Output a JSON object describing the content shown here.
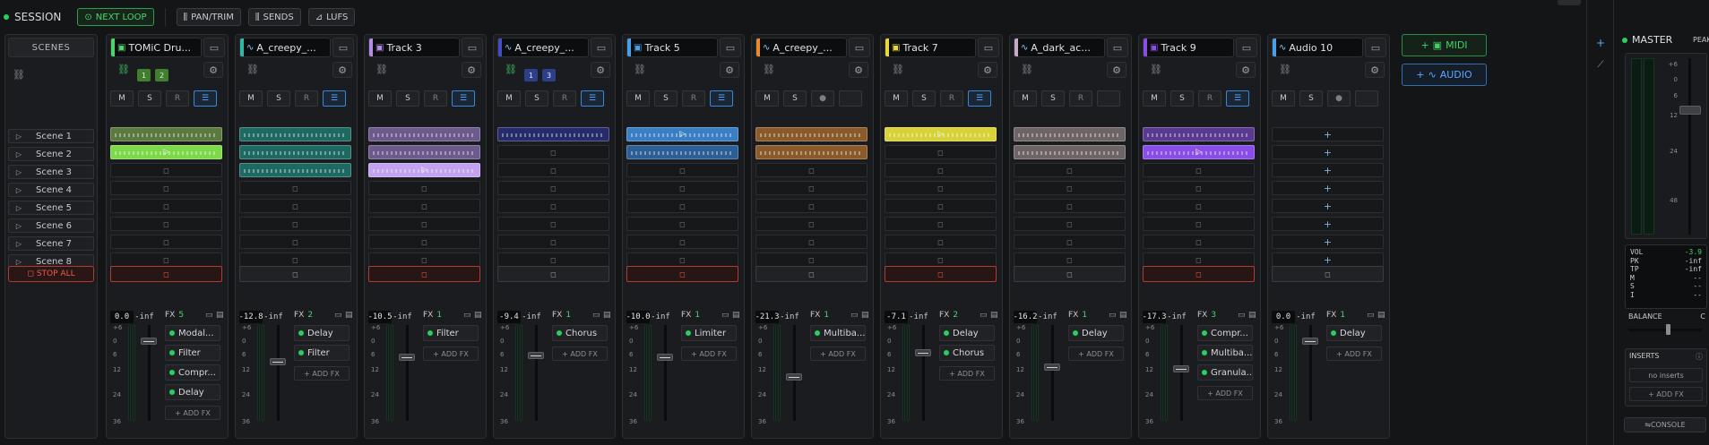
{
  "topbar": {
    "session_label": "SESSION",
    "next_loop": "NEXT LOOP",
    "pan_trim": "PAN/TRIM",
    "sends": "SENDS",
    "lufs": "LUFS"
  },
  "scenes": {
    "header": "SCENES",
    "items": [
      "Scene 1",
      "Scene 2",
      "Scene 3",
      "Scene 4",
      "Scene 5",
      "Scene 6",
      "Scene 7",
      "Scene 8"
    ],
    "stop_all": "STOP ALL"
  },
  "buttons": {
    "mute": "M",
    "solo": "S",
    "rec": "R",
    "monitor_icon": "menu-lines-icon"
  },
  "add_fx_label": "+ ADD FX",
  "tracks": [
    {
      "name": "TOMiC Dru...",
      "kind": "midi",
      "color": "#4fd46c",
      "linked": true,
      "chips": [
        "1",
        "2"
      ],
      "chip_color": "#3f7f2e",
      "vol": "0.0",
      "peak": "-inf",
      "fx_count": "5",
      "fx": [
        "Modal...",
        "Filter",
        "Compr...",
        "Delay"
      ],
      "clips": [
        {
          "c": "#5b7a3f",
          "p": false
        },
        {
          "c": "#7dd84a",
          "p": true
        }
      ],
      "red_stop": true,
      "rec_mode": "R",
      "mon": true,
      "fader": 0.13
    },
    {
      "name": "A_creepy_...",
      "kind": "audio",
      "color": "#2fb8a8",
      "linked": false,
      "chips": [],
      "vol": "-12.8",
      "peak": "-inf",
      "fx_count": "2",
      "fx": [
        "Delay",
        "Filter"
      ],
      "clips": [
        {
          "c": "#1e6a62",
          "p": false
        },
        {
          "c": "#1e6a62",
          "p": false
        },
        {
          "c": "#1e6a62",
          "p": false
        }
      ],
      "red_stop": false,
      "rec_mode": "R",
      "mon": true,
      "fader": 0.35
    },
    {
      "name": "Track 3",
      "kind": "midi",
      "color": "#b58ae8",
      "linked": false,
      "chips": [],
      "vol": "-10.5",
      "peak": "-inf",
      "fx_count": "1",
      "fx": [
        "Filter"
      ],
      "clips": [
        {
          "c": "#6b5a8a",
          "p": false
        },
        {
          "c": "#6b5a8a",
          "p": false
        },
        {
          "c": "#c3a3f0",
          "p": true
        }
      ],
      "red_stop": true,
      "rec_mode": "R",
      "mon": true,
      "fader": 0.3
    },
    {
      "name": "A_creepy_...",
      "kind": "audio",
      "color": "#3f4fc8",
      "linked": true,
      "chips": [
        "1",
        "3"
      ],
      "chip_color": "#2c3f8a",
      "vol": "-9.4",
      "peak": "-inf",
      "fx_count": "1",
      "fx": [
        "Chorus"
      ],
      "clips": [
        {
          "c": "#262c6a",
          "p": false
        }
      ],
      "red_stop": false,
      "rec_mode": "R",
      "mon": true,
      "fader": 0.28
    },
    {
      "name": "Track 5",
      "kind": "midi",
      "color": "#4aa0e8",
      "linked": false,
      "chips": [],
      "vol": "-10.0",
      "peak": "-inf",
      "fx_count": "1",
      "fx": [
        "Limiter"
      ],
      "clips": [
        {
          "c": "#3a7fc4",
          "p": true
        },
        {
          "c": "#2b5f96",
          "p": false
        }
      ],
      "red_stop": true,
      "rec_mode": "R",
      "mon": true,
      "fader": 0.3
    },
    {
      "name": "A_creepy_...",
      "kind": "audio",
      "color": "#e88a2e",
      "linked": false,
      "chips": [],
      "vol": "-21.3",
      "peak": "-inf",
      "fx_count": "1",
      "fx": [
        "Multiba..."
      ],
      "clips": [
        {
          "c": "#8a5a2a",
          "p": false
        },
        {
          "c": "#8a5a2a",
          "p": false
        }
      ],
      "red_stop": false,
      "rec_mode": "●",
      "mon": false,
      "fader": 0.5
    },
    {
      "name": "Track 7",
      "kind": "midi",
      "color": "#e8d83a",
      "linked": false,
      "chips": [],
      "vol": "-7.1",
      "peak": "-inf",
      "fx_count": "2",
      "fx": [
        "Delay",
        "Chorus"
      ],
      "clips": [
        {
          "c": "#d8d23a",
          "p": true
        }
      ],
      "red_stop": true,
      "rec_mode": "R",
      "mon": true,
      "fader": 0.25
    },
    {
      "name": "A_dark_ac...",
      "kind": "audio",
      "color": "#c8a8c8",
      "linked": false,
      "chips": [],
      "vol": "-16.2",
      "peak": "-inf",
      "fx_count": "1",
      "fx": [
        "Delay"
      ],
      "clips": [
        {
          "c": "#6e6466",
          "p": false
        },
        {
          "c": "#6e6466",
          "p": false
        }
      ],
      "red_stop": false,
      "rec_mode": "R",
      "mon": false,
      "fader": 0.4
    },
    {
      "name": "Track 9",
      "kind": "midi",
      "color": "#8a4ee8",
      "linked": false,
      "chips": [],
      "vol": "-17.3",
      "peak": "-inf",
      "fx_count": "3",
      "fx": [
        "Compr...",
        "Multiba...",
        "Granula..."
      ],
      "clips": [
        {
          "c": "#5a3a90",
          "p": false
        },
        {
          "c": "#8a4ee8",
          "p": true
        }
      ],
      "red_stop": true,
      "rec_mode": "R",
      "mon": true,
      "fader": 0.42
    },
    {
      "name": "Audio 10",
      "kind": "audio",
      "color": "#4aa0e8",
      "linked": false,
      "chips": [],
      "vol": "0.0",
      "peak": "-inf",
      "fx_count": "1",
      "fx": [
        "Delay"
      ],
      "clips": [],
      "red_stop": false,
      "rec_mode": "●",
      "mon": false,
      "fader": 0.13,
      "plus_slots": true
    }
  ],
  "scale_labels": [
    "+6",
    "0",
    "6",
    "12",
    "24",
    "36"
  ],
  "add_panel": {
    "midi": "MIDI",
    "audio": "AUDIO"
  },
  "master": {
    "title": "MASTER",
    "peak_label": "PEAK",
    "scale": [
      "+6",
      "0",
      "6",
      "12",
      "24",
      "48"
    ],
    "vol_label": "VOL",
    "vol": "-3.9",
    "pk_label": "PK",
    "pk": "-inf",
    "tp_label": "TP",
    "tp": "-inf",
    "m_label": "M",
    "m": "--",
    "s_label": "S",
    "s": "--",
    "i_label": "I",
    "i": "--",
    "balance": "BALANCE",
    "balance_c": "C",
    "inserts": "INSERTS",
    "no_inserts": "no inserts",
    "add_fx": "+ ADD FX",
    "console": "CONSOLE"
  },
  "colors": {
    "accent_green": "#2ccf5a",
    "accent_blue": "#5aa8ff",
    "stop_red": "#ef5a4e"
  }
}
